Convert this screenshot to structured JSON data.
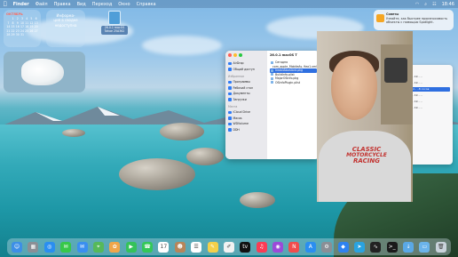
{
  "menubar": {
    "apple_icon": "apple-icon",
    "app_name": "Finder",
    "items": [
      "Файл",
      "Правка",
      "Вид",
      "Переход",
      "Окно",
      "Справка"
    ],
    "clock": "18:46"
  },
  "widgets": {
    "calendar": {
      "month": "ОКТЯБРЬ",
      "weeks": [
        [
          "",
          "1",
          "2",
          "3",
          "4",
          "5",
          "6"
        ],
        [
          "7",
          "8",
          "9",
          "10",
          "11",
          "12",
          "13"
        ],
        [
          "14",
          "15",
          "16",
          "17",
          "18",
          "19",
          "20"
        ],
        [
          "21",
          "22",
          "23",
          "24",
          "25",
          "26",
          "27"
        ],
        [
          "28",
          "29",
          "30",
          "31",
          "",
          "",
          ""
        ]
      ]
    },
    "info": {
      "line1": "Информа-",
      "line2": "ция в сводке",
      "line3": "недоступна"
    }
  },
  "desktop_file": {
    "label_line1": "26.0.1 macOS",
    "label_line2": "Tahoe 25A362"
  },
  "notification": {
    "title": "Советы",
    "body": "Узнайте, как быстрее произносимость объекты с помощью Spotlight."
  },
  "finder": {
    "title": "26.0.1 macOS T",
    "sidebar": {
      "favorites": [
        "AirDrop",
        "Общий доступ"
      ],
      "section_favorites": "Избранное",
      "favorites2": [
        "Программы",
        "Рабочий стол",
        "Документы",
        "Загрузки"
      ],
      "section_places": "Места",
      "places": [
        "iCloud Drive",
        "Macos",
        "WDVolume",
        "DDH"
      ]
    },
    "files": [
      {
        "name": "Сегодня",
        "selected": false
      },
      {
        "name": "com_apple_MobileAs..9ea1.xml",
        "selected": false
      },
      {
        "name": "InstallAssistant.pkg",
        "selected": true
      },
      {
        "name": "BuildInfo.plist",
        "selected": false
      },
      {
        "name": "MajorOSInfo.pkg",
        "selected": false
      },
      {
        "name": "OSInfoPlugin.plist",
        "selected": false
      }
    ]
  },
  "preview": {
    "rows": [
      "Кол.. 19 .. ..",
      "Кол.. 19 .. ..",
      "Прил.. ..8 сосов",
      "Кол.. 19 .. ..",
      "Кол.. 19 .. ..",
      "Кол.. 19 .. .."
    ],
    "selected_index": 2
  },
  "webcam": {
    "shirt_text_line1": "CLASSIC",
    "shirt_text_line2": "MOTORCYCLE",
    "shirt_text_line3": "RACING"
  },
  "dock": {
    "icons": [
      {
        "name": "finder-icon",
        "color": "#3d8fe6",
        "glyph": "☺"
      },
      {
        "name": "launchpad-icon",
        "color": "#8a8f96",
        "glyph": "▦"
      },
      {
        "name": "safari-icon",
        "color": "#2a8ef0",
        "glyph": "◎"
      },
      {
        "name": "messages-icon",
        "color": "#37c84a",
        "glyph": "✉"
      },
      {
        "name": "mail-icon",
        "color": "#3a8ff0",
        "glyph": "✉"
      },
      {
        "name": "maps-icon",
        "color": "#56b95a",
        "glyph": "⌖"
      },
      {
        "name": "photos-icon",
        "color": "#f0a64a",
        "glyph": "✿"
      },
      {
        "name": "facetime-icon",
        "color": "#35c25a",
        "glyph": "▶"
      },
      {
        "name": "phone-icon",
        "color": "#34c759",
        "glyph": "☎"
      },
      {
        "name": "calendar-icon",
        "color": "#ffffff",
        "glyph": "17"
      },
      {
        "name": "contacts-icon",
        "color": "#b7855a",
        "glyph": "☻"
      },
      {
        "name": "reminders-icon",
        "color": "#ffffff",
        "glyph": "☰"
      },
      {
        "name": "notes-icon",
        "color": "#f5d04a",
        "glyph": "✎"
      },
      {
        "name": "freeform-icon",
        "color": "#f2f2f2",
        "glyph": "✐"
      },
      {
        "name": "tv-icon",
        "color": "#111111",
        "glyph": "tv"
      },
      {
        "name": "music-icon",
        "color": "#fa3c55",
        "glyph": "♫"
      },
      {
        "name": "podcasts-icon",
        "color": "#9b4ad8",
        "glyph": "◉"
      },
      {
        "name": "news-icon",
        "color": "#f24c4c",
        "glyph": "N"
      },
      {
        "name": "appstore-icon",
        "color": "#2a8ef0",
        "glyph": "A"
      },
      {
        "name": "settings-icon",
        "color": "#8a8f96",
        "glyph": "⚙"
      },
      {
        "name": "keynote-icon",
        "color": "#2e82f0",
        "glyph": "◆"
      },
      {
        "name": "telegram-icon",
        "color": "#2aa3e0",
        "glyph": "➤"
      },
      {
        "name": "activity-monitor-icon",
        "color": "#222222",
        "glyph": "∿"
      },
      {
        "name": "terminal-icon",
        "color": "#1a1a1a",
        "glyph": ">_"
      },
      {
        "name": "downloads-folder-icon",
        "color": "#5aa8e6",
        "glyph": "↓"
      },
      {
        "name": "folder-icon",
        "color": "#6bb4ea",
        "glyph": "▭"
      },
      {
        "name": "trash-icon",
        "color": "#c9d3db",
        "glyph": "🗑"
      }
    ]
  }
}
